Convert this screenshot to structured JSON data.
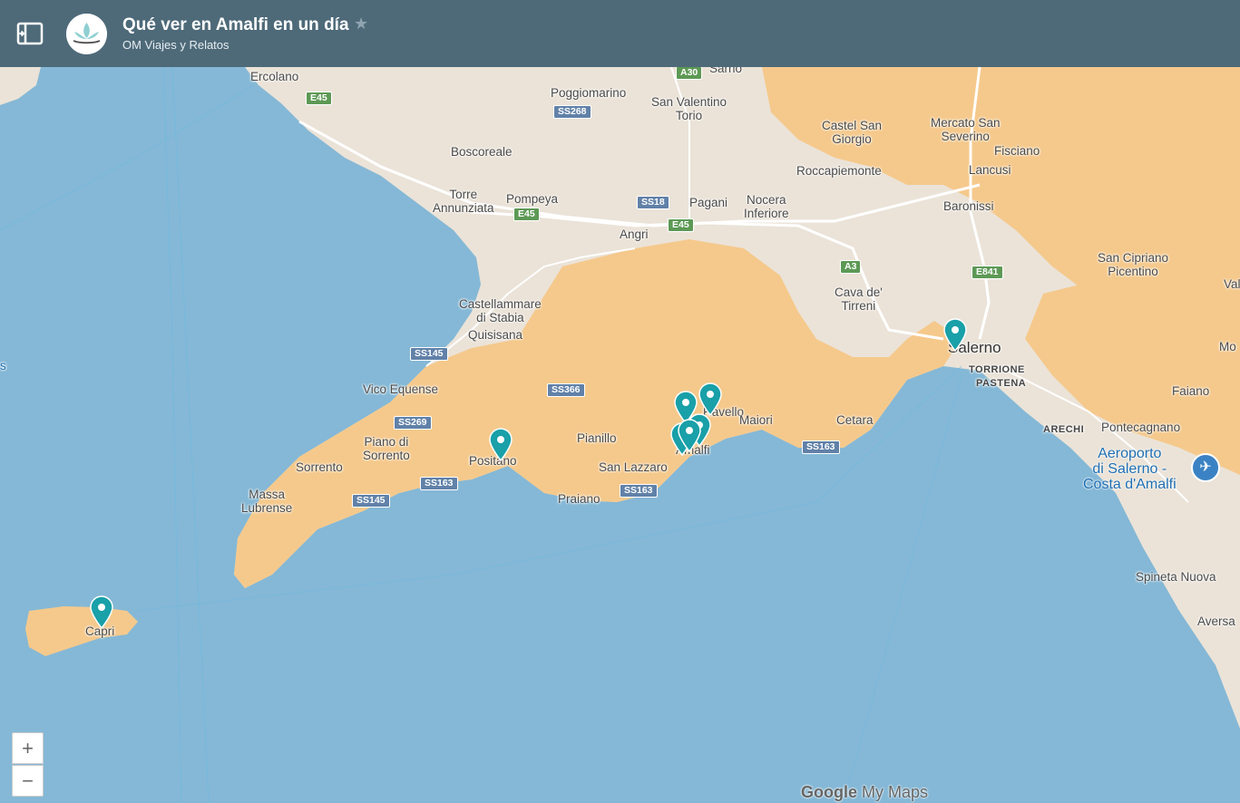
{
  "header": {
    "title": "Qué ver en Amalfi en un día",
    "author": "OM Viajes y Relatos",
    "star_icon": "star-icon",
    "panel_icon": "panel-toggle-icon"
  },
  "colors": {
    "header_bg": "#4e6a79",
    "sea": "#85b8d6",
    "land": "#ebe3d8",
    "hills": "#f5c98c",
    "marker": "#19a0a8"
  },
  "map": {
    "labels": {
      "ercolano": "Ercolano",
      "poggiomarino": "Poggiomarino",
      "san_valentino": "San Valentino\nTorio",
      "sarno": "Sarno",
      "castel_san_giorgio": "Castel San\nGiorgio",
      "mercato_san_severino": "Mercato San\nSeverino",
      "fisciano": "Fisciano",
      "boscoreale": "Boscoreale",
      "roccapiemonte": "Roccapiemonte",
      "lancusi": "Lancusi",
      "torre_annunziata": "Torre\nAnnunziata",
      "pompeya": "Pompeya",
      "pagani": "Pagani",
      "nocera_inferiore": "Nocera\nInferiore",
      "baronissi": "Baronissi",
      "angri": "Angri",
      "san_cipriano_picentino": "San Cipriano\nPicentino",
      "castellammare": "Castellammare\ndi Stabia",
      "cava": "Cava de'\nTirreni",
      "quisisana": "Quisisana",
      "salerno": "Salerno",
      "torrione": "TORRIONE",
      "pastena": "PASTENA",
      "vico_equense": "Vico Equense",
      "ravello": "Ravello",
      "maiori": "Maiori",
      "cetara": "Cetara",
      "faiano": "Faiano",
      "arechi": "ARECHI",
      "pontecagnano": "Pontecagnano",
      "piano_di_sorrento": "Piano di\nSorrento",
      "pianillo": "Pianillo",
      "amalfi": "Amalfi",
      "positano": "Positano",
      "sorrento": "Sorrento",
      "san_lazzaro": "San Lazzaro",
      "aeroporto": "Aeroporto\ndi Salerno -\nCosta d'Amalfi",
      "massa_lubrense": "Massa\nLubrense",
      "praiano": "Praiano",
      "spineta_nuova": "Spineta Nuova",
      "capri": "Capri",
      "aversa": "Aversa",
      "mo": "Mo",
      "val": "Val",
      "s_edge": "s"
    },
    "roads": {
      "a30": "A30",
      "e45_a": "E45",
      "ss268": "SS268",
      "ss18": "SS18",
      "e45_b": "E45",
      "e45_c": "E45",
      "a3": "A3",
      "e841": "E841",
      "ss145_a": "SS145",
      "ss366": "SS366",
      "ss269": "SS269",
      "ss163_a": "SS163",
      "ss163_b": "SS163",
      "ss145_b": "SS145",
      "ss163_c": "SS163"
    },
    "markers": [
      "Salerno",
      "Ravello",
      "Ravello 2",
      "Amalfi",
      "Amalfi 2",
      "Amalfi 3",
      "Positano",
      "Capri"
    ]
  },
  "controls": {
    "zoom_in": "+",
    "zoom_out": "−"
  },
  "branding": {
    "google": "Google",
    "mymaps": "My Maps"
  }
}
